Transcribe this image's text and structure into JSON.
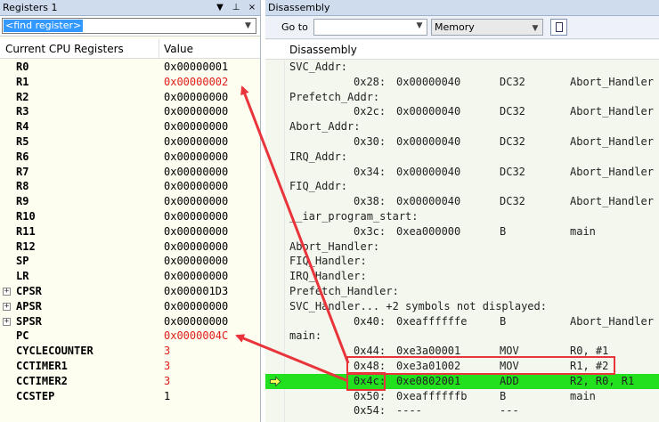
{
  "registers_pane": {
    "title": "Registers 1",
    "title_buttons": [
      "▼",
      "⊥",
      "×"
    ],
    "find_text": "<find register>",
    "col_name": "Current CPU Registers",
    "col_value": "Value",
    "rows": [
      {
        "name": "R0",
        "value": "0x00000001",
        "changed": false,
        "expandable": false
      },
      {
        "name": "R1",
        "value": "0x00000002",
        "changed": true,
        "expandable": false
      },
      {
        "name": "R2",
        "value": "0x00000000",
        "changed": false,
        "expandable": false
      },
      {
        "name": "R3",
        "value": "0x00000000",
        "changed": false,
        "expandable": false
      },
      {
        "name": "R4",
        "value": "0x00000000",
        "changed": false,
        "expandable": false
      },
      {
        "name": "R5",
        "value": "0x00000000",
        "changed": false,
        "expandable": false
      },
      {
        "name": "R6",
        "value": "0x00000000",
        "changed": false,
        "expandable": false
      },
      {
        "name": "R7",
        "value": "0x00000000",
        "changed": false,
        "expandable": false
      },
      {
        "name": "R8",
        "value": "0x00000000",
        "changed": false,
        "expandable": false
      },
      {
        "name": "R9",
        "value": "0x00000000",
        "changed": false,
        "expandable": false
      },
      {
        "name": "R10",
        "value": "0x00000000",
        "changed": false,
        "expandable": false
      },
      {
        "name": "R11",
        "value": "0x00000000",
        "changed": false,
        "expandable": false
      },
      {
        "name": "R12",
        "value": "0x00000000",
        "changed": false,
        "expandable": false
      },
      {
        "name": "SP",
        "value": "0x00000000",
        "changed": false,
        "expandable": false
      },
      {
        "name": "LR",
        "value": "0x00000000",
        "changed": false,
        "expandable": false
      },
      {
        "name": "CPSR",
        "value": "0x000001D3",
        "changed": false,
        "expandable": true
      },
      {
        "name": "APSR",
        "value": "0x00000000",
        "changed": false,
        "expandable": true
      },
      {
        "name": "SPSR",
        "value": "0x00000000",
        "changed": false,
        "expandable": true
      },
      {
        "name": "PC",
        "value": "0x0000004C",
        "changed": true,
        "expandable": false
      },
      {
        "name": "CYCLECOUNTER",
        "value": "3",
        "changed": true,
        "expandable": false
      },
      {
        "name": "CCTIMER1",
        "value": "3",
        "changed": true,
        "expandable": false
      },
      {
        "name": "CCTIMER2",
        "value": "3",
        "changed": true,
        "expandable": false
      },
      {
        "name": "CCSTEP",
        "value": "1",
        "changed": false,
        "expandable": false
      }
    ]
  },
  "disassembly_pane": {
    "title": "Disassembly",
    "goto_label": "Go to",
    "goto_value": "",
    "memory_label": "Memory",
    "header": "Disassembly",
    "rows": [
      {
        "label": "SVC_Addr:"
      },
      {
        "offset": "0x28:",
        "code": "0x00000040",
        "mnemonic": "DC32",
        "operands": "Abort_Handler"
      },
      {
        "label": "Prefetch_Addr:"
      },
      {
        "offset": "0x2c:",
        "code": "0x00000040",
        "mnemonic": "DC32",
        "operands": "Abort_Handler"
      },
      {
        "label": "Abort_Addr:"
      },
      {
        "offset": "0x30:",
        "code": "0x00000040",
        "mnemonic": "DC32",
        "operands": "Abort_Handler"
      },
      {
        "label": "IRQ_Addr:"
      },
      {
        "offset": "0x34:",
        "code": "0x00000040",
        "mnemonic": "DC32",
        "operands": "Abort_Handler"
      },
      {
        "label": "FIQ_Addr:"
      },
      {
        "offset": "0x38:",
        "code": "0x00000040",
        "mnemonic": "DC32",
        "operands": "Abort_Handler"
      },
      {
        "label": "__iar_program_start:"
      },
      {
        "offset": "0x3c:",
        "code": "0xea000000",
        "mnemonic": "B",
        "operands": "main"
      },
      {
        "label": "Abort_Handler:"
      },
      {
        "label": "FIQ_Handler:"
      },
      {
        "label": "IRQ_Handler:"
      },
      {
        "label": "Prefetch_Handler:"
      },
      {
        "label": "SVC_Handler... +2 symbols not displayed:"
      },
      {
        "offset": "0x40:",
        "code": "0xeaffffffe",
        "mnemonic": "B",
        "operands": "Abort_Handler"
      },
      {
        "label": "main:"
      },
      {
        "offset": "0x44:",
        "code": "0xe3a00001",
        "mnemonic": "MOV",
        "operands": "R0, #1"
      },
      {
        "offset": "0x48:",
        "code": "0xe3a01002",
        "mnemonic": "MOV",
        "operands": "R1, #2"
      },
      {
        "offset": "0x4c:",
        "code": "0xe0802001",
        "mnemonic": "ADD",
        "operands": "R2, R0, R1",
        "current": true
      },
      {
        "offset": "0x50:",
        "code": "0xeaffffffb",
        "mnemonic": "B",
        "operands": "main"
      },
      {
        "offset": "0x54:",
        "code": "----",
        "mnemonic": "---",
        "operands": ""
      }
    ]
  },
  "colors": {
    "changed_value": "#e0201a",
    "current_line": "#22e01e",
    "annotation": "#e8343a"
  }
}
